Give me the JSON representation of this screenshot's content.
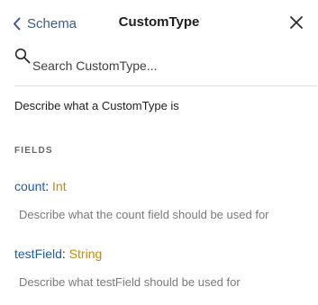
{
  "header": {
    "back_label": "Schema",
    "title": "CustomType"
  },
  "search": {
    "placeholder": "Search CustomType..."
  },
  "description": "Describe what a CustomType is",
  "fields_section": {
    "title": "FIELDS",
    "fields": [
      {
        "name": "count",
        "separator": ": ",
        "type": "Int",
        "description": "Describe what the count field should be used for"
      },
      {
        "name": "testField",
        "separator": ": ",
        "type": "String",
        "description": "Describe what testField should be used for"
      }
    ]
  },
  "colors": {
    "field_name": "#1f5c9e",
    "field_type": "#c88a00",
    "back_link": "#3d5a8f"
  }
}
